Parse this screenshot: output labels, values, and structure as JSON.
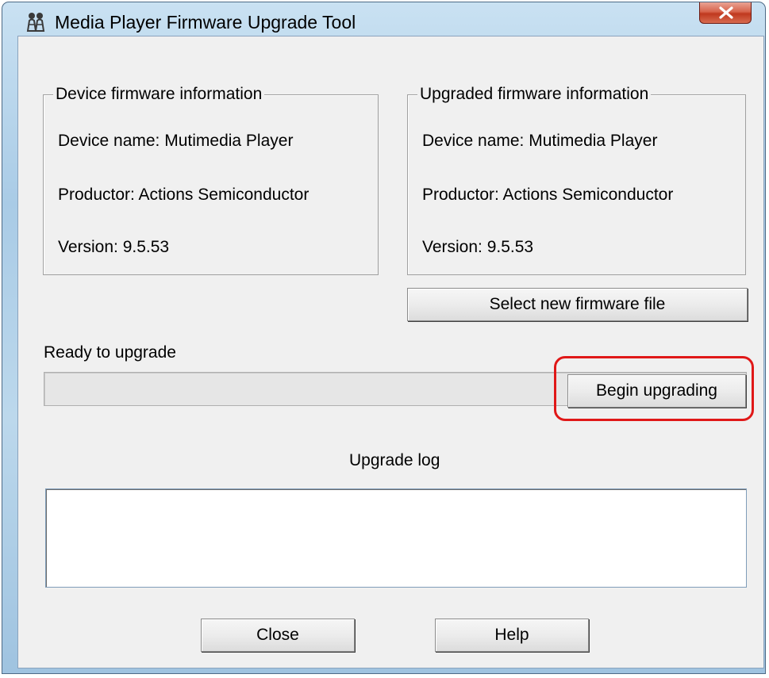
{
  "window": {
    "title": "Media Player Firmware Upgrade Tool",
    "app_icon": "figures-icon",
    "close_icon": "close-icon"
  },
  "device_info": {
    "legend": "Device firmware information",
    "name": "Device name: Mutimedia Player",
    "producer": "Productor: Actions Semiconductor",
    "version": "Version: 9.5.53"
  },
  "upgraded_info": {
    "legend": "Upgraded firmware information",
    "name": "Device name: Mutimedia Player",
    "producer": "Productor: Actions Semiconductor",
    "version": "Version: 9.5.53"
  },
  "buttons": {
    "select_file": "Select new firmware file",
    "begin": "Begin upgrading",
    "close": "Close",
    "help": "Help"
  },
  "status": {
    "text": "Ready to upgrade",
    "progress": 0
  },
  "log": {
    "label": "Upgrade log",
    "content": ""
  },
  "colors": {
    "annotation": "#e01818",
    "close_button": "#c0391f"
  }
}
